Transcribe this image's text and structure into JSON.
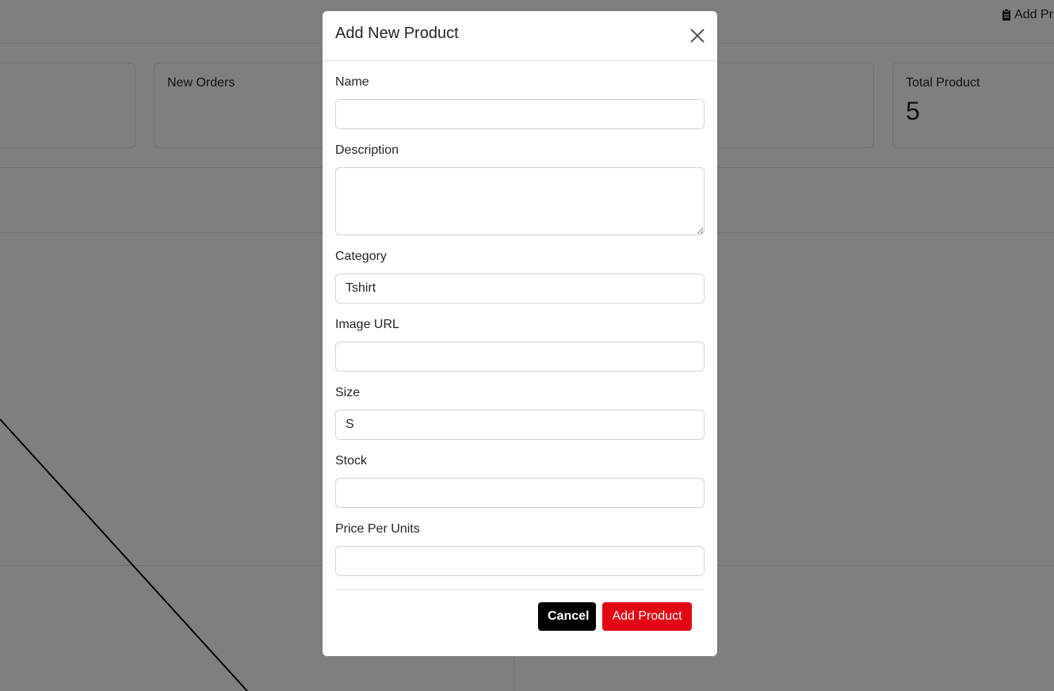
{
  "background": {
    "top_action_label": "Add Pr",
    "stats": [
      {
        "title": "",
        "value": ""
      },
      {
        "title": "New Orders",
        "value": ""
      },
      {
        "title": "",
        "value": ""
      },
      {
        "title": "Total Product",
        "value": "5"
      }
    ]
  },
  "modal": {
    "title": "Add New Product",
    "fields": {
      "name": {
        "label": "Name",
        "value": ""
      },
      "description": {
        "label": "Description",
        "value": ""
      },
      "category": {
        "label": "Category",
        "value": "Tshirt"
      },
      "image_url": {
        "label": "Image URL",
        "value": ""
      },
      "size": {
        "label": "Size",
        "value": "S"
      },
      "stock": {
        "label": "Stock",
        "value": ""
      },
      "price": {
        "label": "Price Per Units",
        "value": ""
      }
    },
    "cancel_label": "Cancel",
    "submit_label": "Add Product"
  },
  "colors": {
    "backdrop": "#808080",
    "cancel_button": "#000000",
    "submit_button": "#e30613"
  },
  "icons": {
    "close": "close-icon",
    "top_action": "clipboard-icon"
  }
}
